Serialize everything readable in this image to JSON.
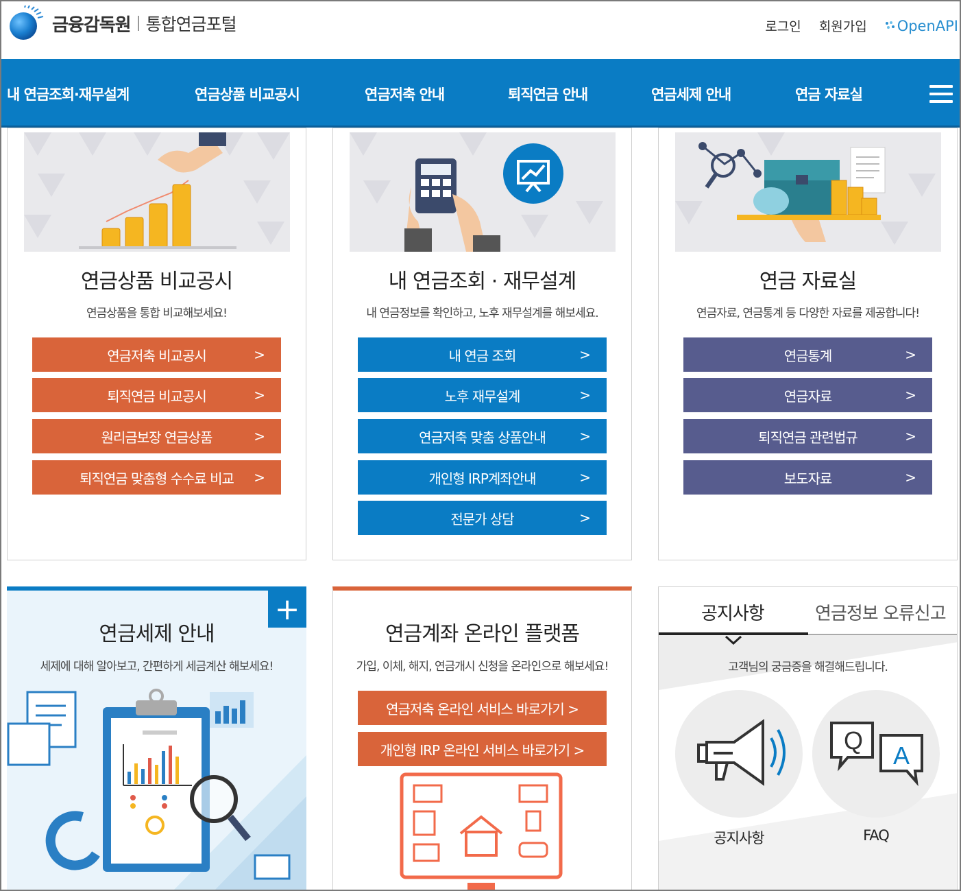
{
  "header": {
    "org_name": "금융감독원",
    "portal_name": "통합연금포털",
    "login": "로그인",
    "signup": "회원가입",
    "openapi": "OpenAPI"
  },
  "gnb": {
    "items": [
      "내 연금조회·재무설계",
      "연금상품 비교공시",
      "연금저축 안내",
      "퇴직연금 안내",
      "연금세제 안내",
      "연금 자료실"
    ]
  },
  "cards": [
    {
      "title": "연금상품 비교공시",
      "desc": "연금상품을 통합 비교해보세요!",
      "buttons": [
        "연금저축 비교공시",
        "퇴직연금 비교공시",
        "원리금보장 연금상품",
        "퇴직연금 맞춤형 수수료 비교"
      ]
    },
    {
      "title": "내 연금조회 · 재무설계",
      "desc": "내 연금정보를 확인하고, 노후 재무설계를 해보세요.",
      "buttons": [
        "내 연금 조회",
        "노후 재무설계",
        "연금저축 맞춤 상품안내",
        "개인형 IRP계좌안내",
        "전문가 상담"
      ]
    },
    {
      "title": "연금 자료실",
      "desc": "연금자료, 연금통계 등 다양한 자료를 제공합니다!",
      "buttons": [
        "연금통계",
        "연금자료",
        "퇴직연금 관련법규",
        "보도자료"
      ]
    }
  ],
  "arrow": ">",
  "tax": {
    "title": "연금세제 안내",
    "desc": "세제에 대해 알아보고, 간편하게 세금계산 해보세요!",
    "plus": "+"
  },
  "online": {
    "title": "연금계좌 온라인 플랫폼",
    "desc": "가입, 이체, 해지, 연금개시 신청을 온라인으로 해보세요!",
    "buttons": [
      "연금저축 온라인 서비스 바로가기 >",
      "개인형 IRP 온라인 서비스 바로가기 >"
    ]
  },
  "notice": {
    "tab_active": "공지사항",
    "tab_inactive": "연금정보 오류신고",
    "desc": "고객님의 궁금증을 해결해드립니다.",
    "items": [
      "공지사항",
      "FAQ"
    ],
    "q_letter": "Q",
    "a_letter": "A"
  },
  "colors": {
    "brand_blue": "#0a7cc4",
    "orange": "#d9643a",
    "purple": "#575c8e"
  }
}
